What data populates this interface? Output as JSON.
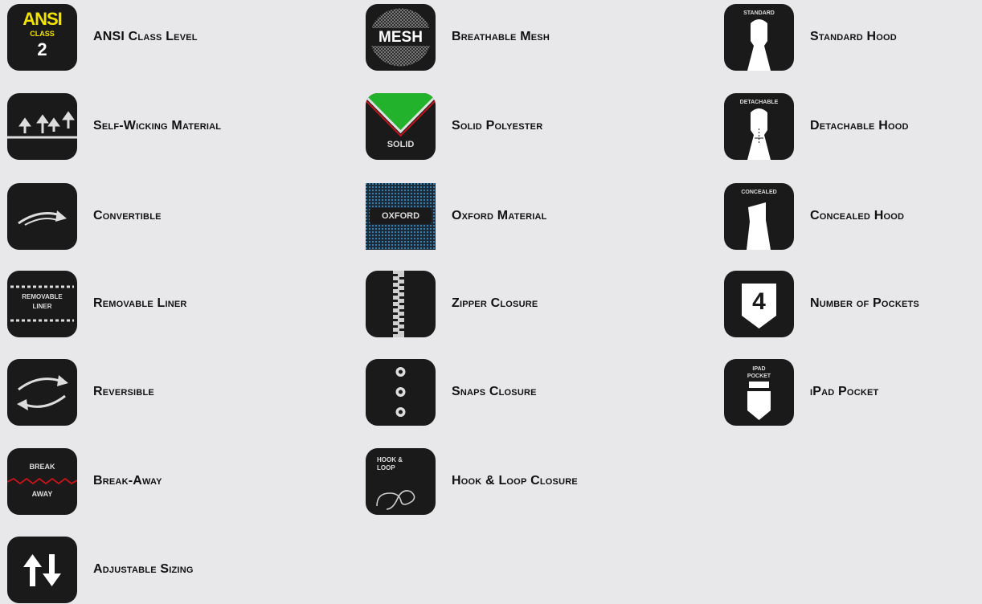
{
  "features": [
    {
      "label": "ANSI Class Level",
      "icon": "ansi-class-icon",
      "icon_text": [
        "ANSI",
        "CLASS",
        "2"
      ]
    },
    {
      "label": "Self-Wicking Material",
      "icon": "self-wicking-icon"
    },
    {
      "label": "Convertible",
      "icon": "convertible-icon"
    },
    {
      "label": "Removable Liner",
      "icon": "removable-liner-icon",
      "icon_text": [
        "REMOVABLE",
        "LINER"
      ]
    },
    {
      "label": "Reversible",
      "icon": "reversible-icon"
    },
    {
      "label": "Break-Away",
      "icon": "break-away-icon",
      "icon_text": [
        "BREAK",
        "AWAY"
      ]
    },
    {
      "label": "Adjustable Sizing",
      "icon": "adjustable-sizing-icon"
    },
    {
      "label": "Breathable Mesh",
      "icon": "mesh-icon",
      "icon_text": [
        "MESH"
      ]
    },
    {
      "label": "Solid Polyester",
      "icon": "solid-polyester-icon",
      "icon_text": [
        "SOLID"
      ]
    },
    {
      "label": "Oxford Material",
      "icon": "oxford-icon",
      "icon_text": [
        "OXFORD"
      ]
    },
    {
      "label": "Zipper Closure",
      "icon": "zipper-icon"
    },
    {
      "label": "Snaps Closure",
      "icon": "snaps-icon"
    },
    {
      "label": "Hook & Loop Closure",
      "icon": "hook-loop-icon",
      "icon_text": [
        "HOOK &",
        "LOOP"
      ]
    },
    {
      "label": "Standard Hood",
      "icon": "standard-hood-icon",
      "icon_text": [
        "STANDARD"
      ]
    },
    {
      "label": "Detachable Hood",
      "icon": "detachable-hood-icon",
      "icon_text": [
        "DETACHABLE"
      ]
    },
    {
      "label": "Concealed Hood",
      "icon": "concealed-hood-icon",
      "icon_text": [
        "CONCEALED"
      ]
    },
    {
      "label": "Number of Pockets",
      "icon": "number-of-pockets-icon",
      "icon_text": [
        "4"
      ]
    },
    {
      "label": "iPad Pocket",
      "icon": "ipad-pocket-icon",
      "icon_text": [
        "IPAD",
        "POCKET"
      ]
    }
  ],
  "colors": {
    "ansi_yellow": "#f2e400",
    "solid_green": "#22b22c",
    "oxford_blue": "#2f7fb0",
    "breakaway_red": "#c0141c"
  }
}
